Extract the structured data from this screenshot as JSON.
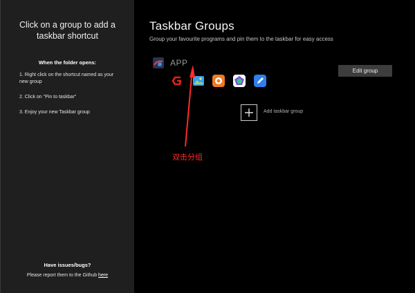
{
  "sidebar": {
    "title": "Click on a group to add a taskbar shortcut",
    "folder_heading": "When the folder opens:",
    "steps": [
      "1. Right click on the shortcut named as your new group",
      "2. Click on \"Pin to taskbar\"",
      "3. Enjoy your new Taskbar group"
    ],
    "issues_heading": "Have issues/bugs?",
    "report_text": "Please report them to the Github",
    "report_link": "here"
  },
  "main": {
    "title": "Taskbar Groups",
    "subtitle": "Group your favourite programs and pin them to the taskbar for easy access",
    "group": {
      "name": "APP",
      "edit_label": "Edit group",
      "apps": [
        {
          "icon": "red-g-app-icon",
          "color": "#e2231a"
        },
        {
          "icon": "image-viewer-icon",
          "color": "#3aa0e8"
        },
        {
          "icon": "orange-app-icon",
          "color": "#f07a22"
        },
        {
          "icon": "pentagon-app-icon",
          "color": "#7b4fd8"
        },
        {
          "icon": "blue-pen-app-icon",
          "color": "#2f80ed"
        }
      ]
    },
    "add_label": "Add taskbar group"
  },
  "annotation": {
    "text": "双击分组",
    "color": "#ff2a2a"
  }
}
